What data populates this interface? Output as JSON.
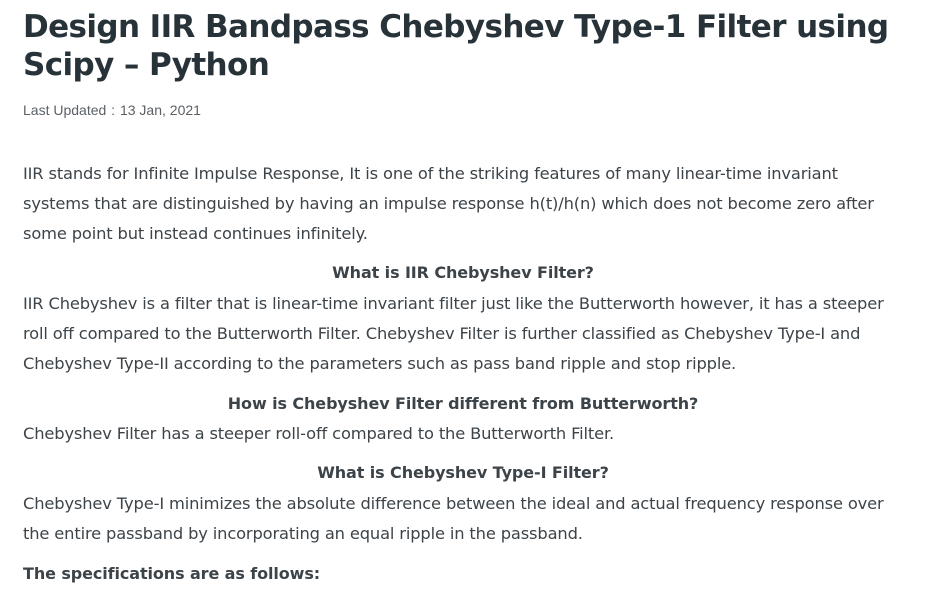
{
  "article": {
    "title": "Design IIR Bandpass Chebyshev Type-1 Filter using Scipy – Python",
    "last_updated_label": "Last Updated",
    "last_updated_date": "13 Jan, 2021",
    "intro": "IIR stands for Infinite Impulse Response, It is one of the striking features of many linear-time invariant systems that are distinguished by having an impulse response h(t)/h(n) which does not become zero after some point but instead continues infinitely.",
    "sections": [
      {
        "heading": "What is IIR Chebyshev Filter?",
        "body": "IIR Chebyshev is a filter that is linear-time invariant filter just like the Butterworth however, it has a steeper roll off compared to the Butterworth Filter. Chebyshev Filter is further classified as Chebyshev Type-I and Chebyshev Type-II according to the parameters such as pass band ripple and stop ripple."
      },
      {
        "heading": "How is Chebyshev Filter different from Butterworth?",
        "body": "Chebyshev Filter has a steeper roll-off compared to the Butterworth Filter."
      },
      {
        "heading": "What is Chebyshev Type-I Filter?",
        "body": "Chebyshev Type-I minimizes the absolute difference between the ideal and actual frequency response over the entire passband by incorporating an equal ripple in the passband."
      }
    ],
    "specs_heading": "The specifications are as follows:"
  }
}
